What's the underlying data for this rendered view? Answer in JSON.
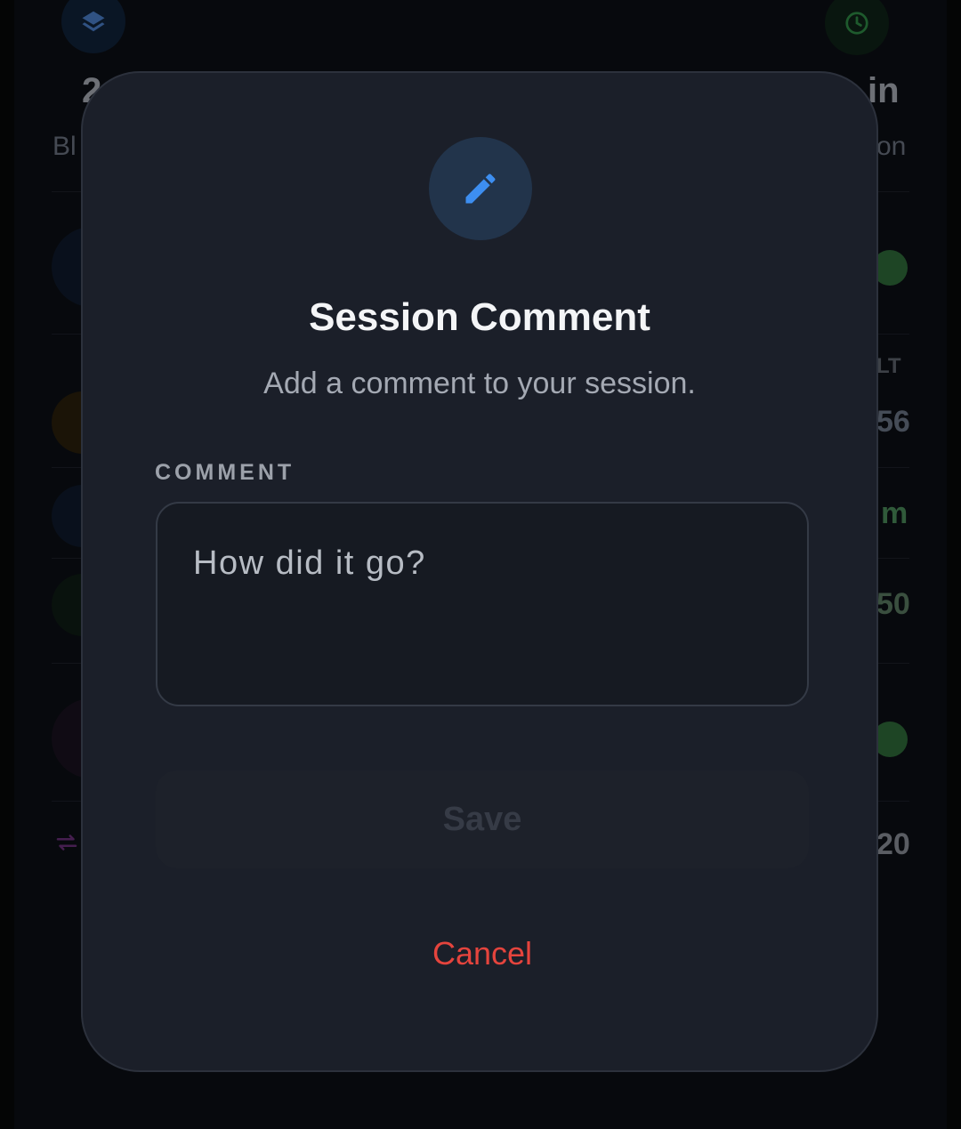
{
  "background": {
    "stat_left_value": "2",
    "stat_left_label": "Bl",
    "stat_right_value": "in",
    "stat_right_label": "on",
    "column_header": "LT",
    "row_values": [
      "56",
      "m",
      "50",
      "20"
    ]
  },
  "modal": {
    "title": "Session Comment",
    "subtitle": "Add a comment to your session.",
    "comment_label": "COMMENT",
    "comment_placeholder": "How did it go?",
    "comment_value": "",
    "save_label": "Save",
    "cancel_label": "Cancel",
    "icon": "pencil-icon"
  },
  "colors": {
    "accent": "#3d8ef0",
    "danger": "#e5443d",
    "surface": "#1b1f29"
  }
}
